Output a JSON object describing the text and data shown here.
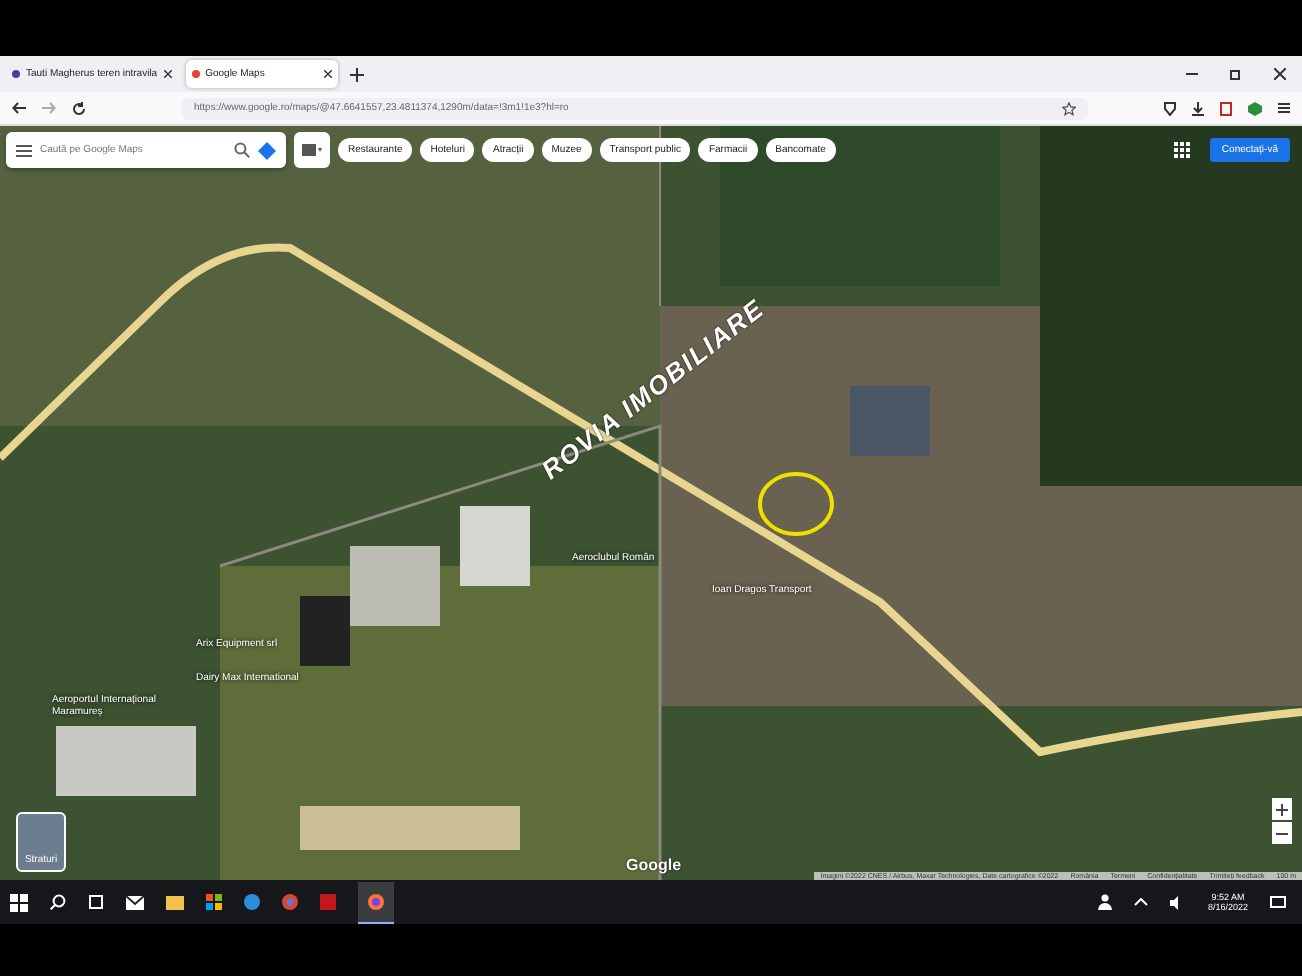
{
  "browser": {
    "tabs": [
      {
        "title": "Tauti Magherus teren intravila",
        "selected": false
      },
      {
        "title": "Google Maps",
        "selected": true
      }
    ],
    "url": "https://www.google.ro/maps/@47.6641557,23.4811374,1290m/data=!3m1!1e3?hl=ro"
  },
  "maps": {
    "search": {
      "placeholder": "Caută pe Google Maps"
    },
    "chips": [
      "Restaurante",
      "Hoteluri",
      "Atracții",
      "Muzee",
      "Transport public",
      "Farmacii",
      "Bancomate"
    ],
    "sign_in": "Conectați-vă",
    "annotation": "ROVIA IMOBILIARE",
    "labels": [
      {
        "text": "Aeroportul Internațional Maramureș"
      },
      {
        "text": "Arix Equipment srl"
      },
      {
        "text": "Dairy Max International"
      },
      {
        "text": "Aeroclubul Român"
      },
      {
        "text": "Ioan Dragos Transport"
      }
    ],
    "layers": "Straturi",
    "logo": "Google",
    "attribution": [
      "Imagini ©2022 CNES / Airbus, Maxar Technologies, Date cartografice ©2022",
      "România",
      "Termeni",
      "Confidențialitate",
      "Trimiteți feedback"
    ],
    "scale": "100 m"
  },
  "taskbar": {
    "time": "9:52 AM",
    "date": "8/16/2022"
  }
}
